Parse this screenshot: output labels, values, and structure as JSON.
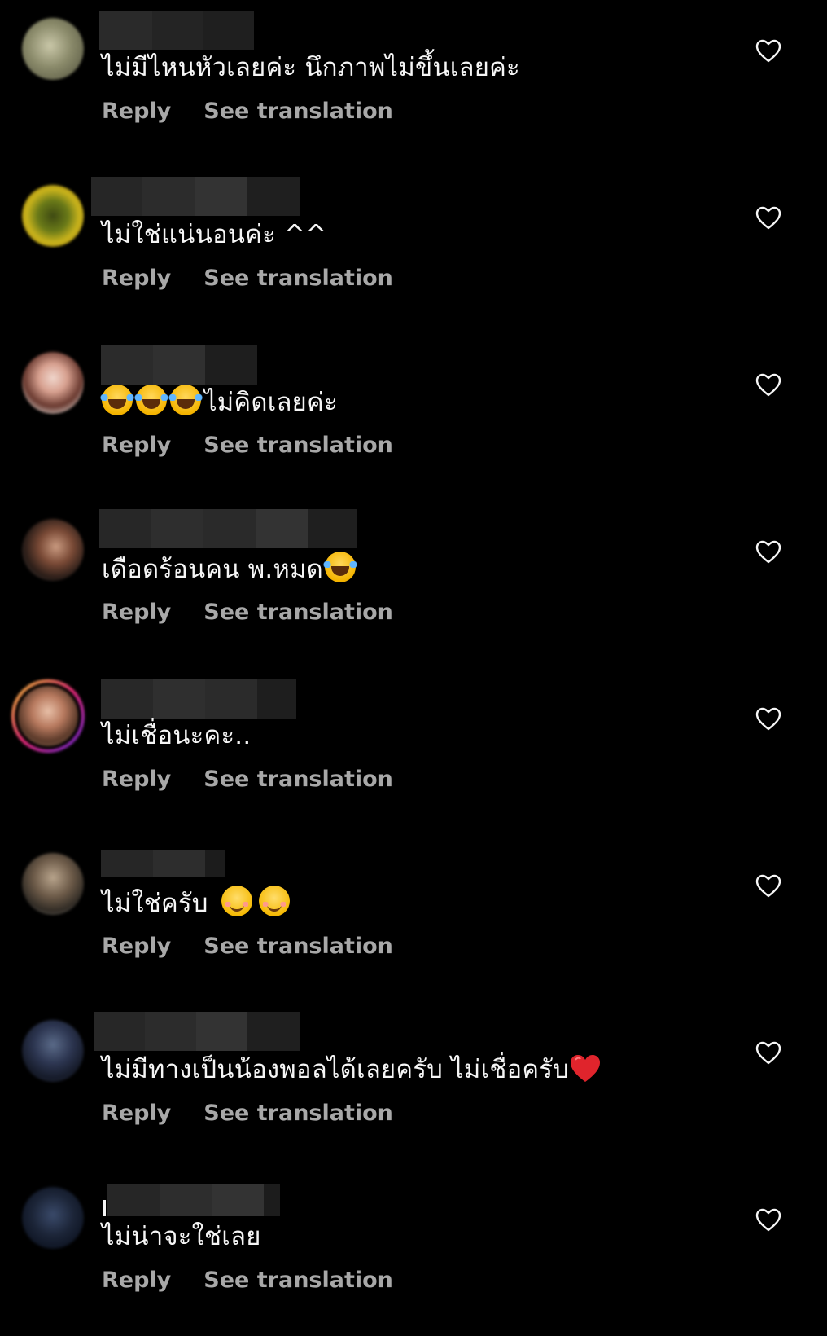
{
  "actions": {
    "reply_label": "Reply",
    "translate_label": "See translation"
  },
  "comments": [
    {
      "text": "ไม่มีไหนหัวเลยค่ะ นึกภาพไม่ขึ้นเลยค่ะ"
    },
    {
      "text": "ไม่ใช่แน่นอนค่ะ ^^"
    },
    {
      "text": "ไม่คิดเลยค่ะ"
    },
    {
      "text": "เดือดร้อนคน พ.หมด"
    },
    {
      "text": "ไม่เชื่อนะคะ.."
    },
    {
      "text": "ไม่ใช่ครับ "
    },
    {
      "text": "ไม่มีทางเป็นน้องพอลได้เลยครับ ไม่เชื่อครับ"
    },
    {
      "text": "ไม่น่าจะใช่เลย"
    }
  ],
  "colors": {
    "background": "#000000",
    "text": "#f5f5f5",
    "muted": "#a8a8a8",
    "redacted": "#2b2b2b"
  }
}
